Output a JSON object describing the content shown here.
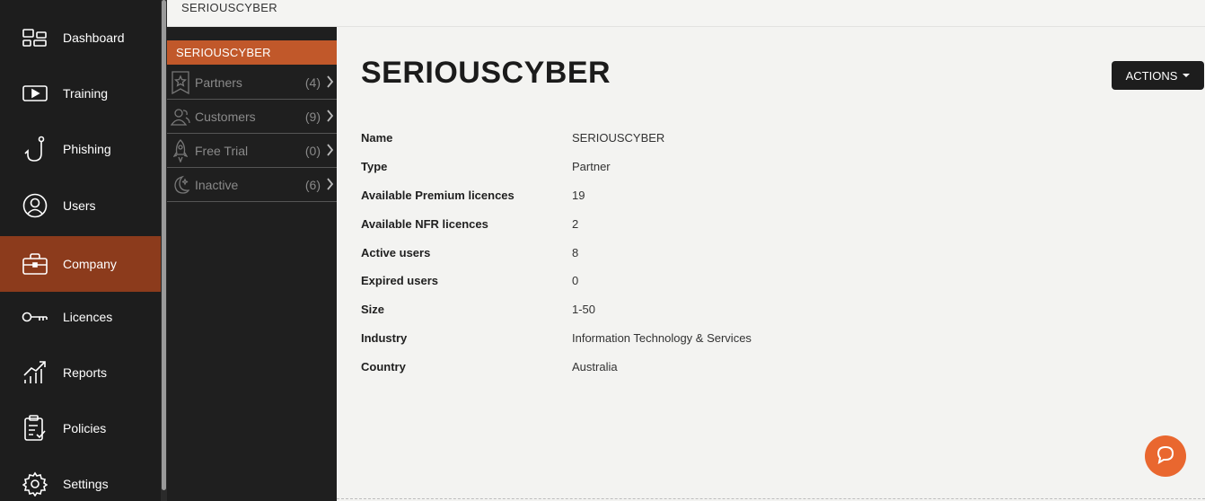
{
  "nav": {
    "items": [
      {
        "label": "Dashboard",
        "icon": "dashboard-icon",
        "active": false
      },
      {
        "label": "Training",
        "icon": "play-icon",
        "active": false
      },
      {
        "label": "Phishing",
        "icon": "fishhook-icon",
        "active": false
      },
      {
        "label": "Users",
        "icon": "user-icon",
        "active": false
      },
      {
        "label": "Company",
        "icon": "briefcase-icon",
        "active": true
      },
      {
        "label": "Licences",
        "icon": "key-icon",
        "active": false
      },
      {
        "label": "Reports",
        "icon": "chart-icon",
        "active": false
      },
      {
        "label": "Policies",
        "icon": "clipboard-icon",
        "active": false
      },
      {
        "label": "Settings",
        "icon": "gear-icon",
        "active": false
      }
    ]
  },
  "breadcrumb": "SERIOUSCYBER",
  "subnav": {
    "header": "SERIOUSCYBER",
    "items": [
      {
        "label": "Partners",
        "count": "(4)",
        "icon": "star-badge-icon"
      },
      {
        "label": "Customers",
        "count": "(9)",
        "icon": "users-icon"
      },
      {
        "label": "Free Trial",
        "count": "(0)",
        "icon": "rocket-icon"
      },
      {
        "label": "Inactive",
        "count": "(6)",
        "icon": "moon-icon"
      }
    ]
  },
  "main": {
    "title": "SERIOUSCYBER",
    "actions_label": "ACTIONS",
    "details": [
      {
        "key": "Name",
        "value": "SERIOUSCYBER"
      },
      {
        "key": "Type",
        "value": "Partner"
      },
      {
        "key": "Available Premium licences",
        "value": "19"
      },
      {
        "key": "Available NFR licences",
        "value": "2"
      },
      {
        "key": "Active users",
        "value": "8"
      },
      {
        "key": "Expired users",
        "value": "0"
      },
      {
        "key": "Size",
        "value": "1-50"
      },
      {
        "key": "Industry",
        "value": "Information Technology & Services"
      },
      {
        "key": "Country",
        "value": "Australia"
      }
    ]
  },
  "colors": {
    "sidebar_bg": "#1d1d1d",
    "active_bg": "#8c3b1c",
    "subhead_bg": "#c1582a",
    "chat_button": "#e9672f"
  }
}
